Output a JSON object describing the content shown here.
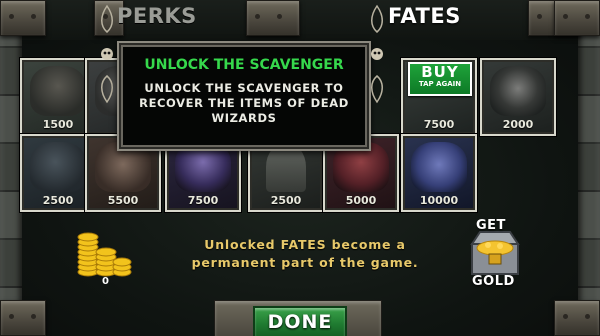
{
  "tabs": {
    "perks": "PERKS",
    "fates": "FATES",
    "active": "FATES"
  },
  "tooltip": {
    "title": "UNLOCK THE SCAVENGER",
    "description": "UNLOCK THE SCAVENGER TO RECOVER THE ITEMS OF DEAD WIZARDS"
  },
  "buy_badge": {
    "buy": "BUY",
    "tap": "TAP AGAIN"
  },
  "cards": [
    {
      "cost": "1500"
    },
    {
      "cost": ""
    },
    {
      "cost": "7500"
    },
    {
      "cost": "2000"
    },
    {
      "cost": "2500"
    },
    {
      "cost": "5500"
    },
    {
      "cost": "7500"
    },
    {
      "cost": "2500"
    },
    {
      "cost": "5000"
    },
    {
      "cost": "10000"
    }
  ],
  "message": "Unlocked FATES become a permanent part of the game.",
  "gold": {
    "count": "0"
  },
  "get_gold": {
    "line1": "GET",
    "line2": "GOLD"
  },
  "done": "DONE",
  "colors": {
    "tooltip_title": "#36d84c",
    "message": "#e8c96a",
    "buy_green": "#1fa33a",
    "done_green": "#2a8c3a"
  }
}
